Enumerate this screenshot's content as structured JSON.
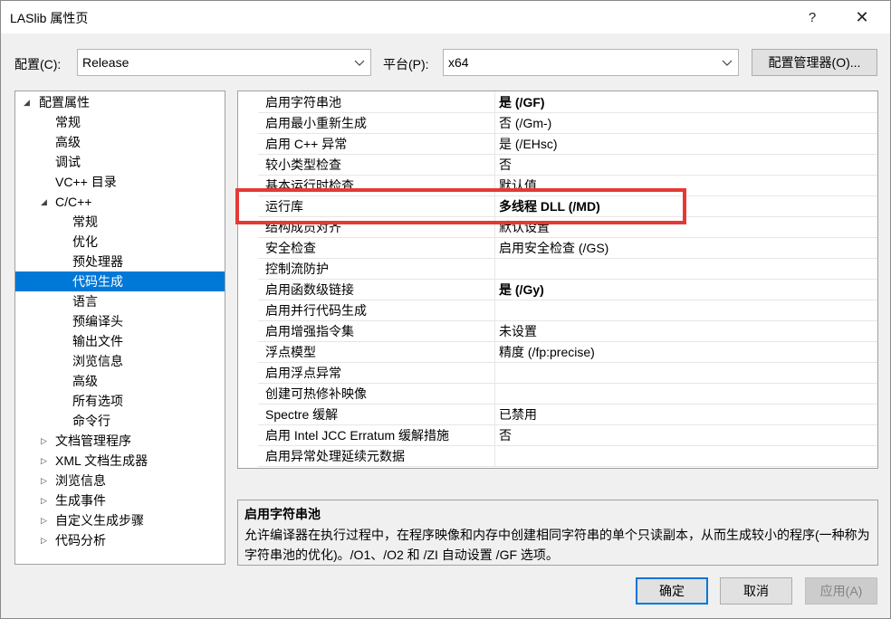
{
  "window": {
    "title": "LASlib 属性页",
    "help_glyph": "?",
    "close_glyph": "✕"
  },
  "config": {
    "label": "配置(C):",
    "value": "Release",
    "platform_label": "平台(P):",
    "platform_value": "x64",
    "manager_button": "配置管理器(O)..."
  },
  "tree": {
    "items": [
      {
        "label": "配置属性",
        "expander": "◢",
        "level": 0
      },
      {
        "label": "常规",
        "expander": "",
        "level": 2
      },
      {
        "label": "高级",
        "expander": "",
        "level": 2
      },
      {
        "label": "调试",
        "expander": "",
        "level": 2
      },
      {
        "label": "VC++ 目录",
        "expander": "",
        "level": 2
      },
      {
        "label": "C/C++",
        "expander": "◢",
        "level": 1
      },
      {
        "label": "常规",
        "expander": "",
        "level": 3
      },
      {
        "label": "优化",
        "expander": "",
        "level": 3
      },
      {
        "label": "预处理器",
        "expander": "",
        "level": 3
      },
      {
        "label": "代码生成",
        "expander": "",
        "level": 3,
        "selected": true
      },
      {
        "label": "语言",
        "expander": "",
        "level": 3
      },
      {
        "label": "预编译头",
        "expander": "",
        "level": 3
      },
      {
        "label": "输出文件",
        "expander": "",
        "level": 3
      },
      {
        "label": "浏览信息",
        "expander": "",
        "level": 3
      },
      {
        "label": "高级",
        "expander": "",
        "level": 3
      },
      {
        "label": "所有选项",
        "expander": "",
        "level": 3
      },
      {
        "label": "命令行",
        "expander": "",
        "level": 3
      },
      {
        "label": "文档管理程序",
        "expander": "▷",
        "level": 1
      },
      {
        "label": "XML 文档生成器",
        "expander": "▷",
        "level": 1
      },
      {
        "label": "浏览信息",
        "expander": "▷",
        "level": 1
      },
      {
        "label": "生成事件",
        "expander": "▷",
        "level": 1
      },
      {
        "label": "自定义生成步骤",
        "expander": "▷",
        "level": 1
      },
      {
        "label": "代码分析",
        "expander": "▷",
        "level": 1
      }
    ]
  },
  "properties": [
    {
      "name": "启用字符串池",
      "value": "是 (/GF)",
      "bold": true
    },
    {
      "name": "启用最小重新生成",
      "value": "否 (/Gm-)",
      "bold": false
    },
    {
      "name": "启用 C++ 异常",
      "value": "是 (/EHsc)",
      "bold": false
    },
    {
      "name": "较小类型检查",
      "value": "否",
      "bold": false
    },
    {
      "name": "基本运行时检查",
      "value": "默认值",
      "bold": false,
      "partial": true
    },
    {
      "name": "运行库",
      "value": "多线程 DLL (/MD)",
      "bold": true,
      "highlighted": true
    },
    {
      "name": "结构成员对齐",
      "value": "默认设置",
      "bold": false,
      "partial": true
    },
    {
      "name": "安全检查",
      "value": "启用安全检查 (/GS)",
      "bold": false
    },
    {
      "name": "控制流防护",
      "value": "",
      "bold": false
    },
    {
      "name": "启用函数级链接",
      "value": "是 (/Gy)",
      "bold": true
    },
    {
      "name": "启用并行代码生成",
      "value": "",
      "bold": false
    },
    {
      "name": "启用增强指令集",
      "value": "未设置",
      "bold": false
    },
    {
      "name": "浮点模型",
      "value": "精度 (/fp:precise)",
      "bold": false
    },
    {
      "name": "启用浮点异常",
      "value": "",
      "bold": false
    },
    {
      "name": "创建可热修补映像",
      "value": "",
      "bold": false
    },
    {
      "name": "Spectre 缓解",
      "value": "已禁用",
      "bold": false
    },
    {
      "name": "启用 Intel JCC Erratum 缓解措施",
      "value": "否",
      "bold": false
    },
    {
      "name": "启用异常处理延续元数据",
      "value": "",
      "bold": false
    }
  ],
  "description": {
    "title": "启用字符串池",
    "text": "允许编译器在执行过程中，在程序映像和内存中创建相同字符串的单个只读副本，从而生成较小的程序(一种称为字符串池的优化)。/O1、/O2 和 /ZI 自动设置 /GF 选项。"
  },
  "buttons": {
    "ok": "确定",
    "cancel": "取消",
    "apply": "应用(A)"
  },
  "colors": {
    "selection": "#0078d7",
    "highlight_box": "#e53935"
  }
}
